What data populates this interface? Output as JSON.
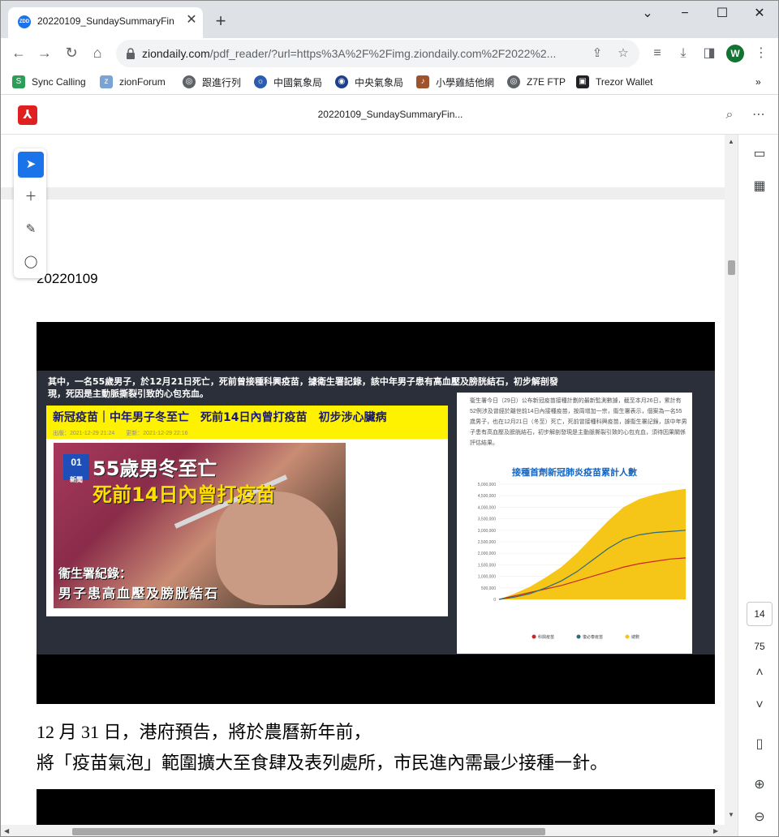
{
  "browser": {
    "tab": {
      "favicon_text": "ZDD",
      "title": "20220109_SundaySummaryFin",
      "close": "✕"
    },
    "new_tab": "+",
    "window_controls": {
      "minimize": "−",
      "maximize": "☐",
      "close": "✕"
    },
    "url_host": "ziondaily.com",
    "url_path": "/pdf_reader/?url=https%3A%2F%2Fimg.ziondaily.com%2F2022%2...",
    "profile_initial": "W"
  },
  "bookmarks": [
    {
      "label": "Sync Calling",
      "icon": "sync-calling-icon",
      "color": "#2e9d57"
    },
    {
      "label": "zionForum",
      "icon": "zionforum-icon",
      "color": "#7aa3d6"
    },
    {
      "label": "跟進行列",
      "icon": "globe-icon",
      "color": "#5f6368"
    },
    {
      "label": "中國氣象局",
      "icon": "cma-icon",
      "color": "#2a5db0"
    },
    {
      "label": "中央氣象局",
      "icon": "cwb-icon",
      "color": "#1e3f8a"
    },
    {
      "label": "小學雞結他網",
      "icon": "guitar-icon",
      "color": "#a0522d"
    },
    {
      "label": "Z7E FTP",
      "icon": "globe-icon",
      "color": "#5f6368"
    },
    {
      "label": "Trezor Wallet",
      "icon": "trezor-icon",
      "color": "#202124"
    }
  ],
  "pdf": {
    "title": "20220109_SundaySummaryFin...",
    "date_text": "20220109",
    "page_current": "14",
    "page_total": "75"
  },
  "article": {
    "quote": "其中，一名55歲男子，於12月21日死亡，死前曾接種科興疫苗，據衛生署記錄，該中年男子患有高血壓及膀胱結石，初步解剖發現，死因是主動脈撕裂引致的心包充血。",
    "headline": "新冠疫苗｜中年男子冬至亡　死前14日內曾打疫苗　初步涉心臟病",
    "meta": "出版：2021-12-29 21:24　　更新：2021-12-29 22:16",
    "badge": "01",
    "badge_sub": "新聞",
    "photo_h1": "55歲男冬至亡",
    "photo_h2": "死前14日內曾打疫苗",
    "photo_cap1": "衞生署紀錄：",
    "photo_cap2": "男子患高血壓及膀胱結石",
    "chart_note": "衞生署今日（29日）公布新冠疫苗接種計劃的最新監測數據，截至本月26日，累計有52例涉及曾經於離世前14日內接種疫苗，按周增加一宗，衞生署表示，個案為一名55歲男子，也在12月21日（冬至）死亡，死前曾接種科興疫苗，據衞生署記錄，該中年男子患有高血壓及膀胱結石，初步解剖發現是主動脈撕裂引致的心包充血，須待因果關係評估結果。",
    "chart_title": "接種首劑新冠肺炎疫苗累計人數",
    "body_line1": "12 月 31 日，港府預告，將於農曆新年前，",
    "body_line2": "將「疫苗氣泡」範圍擴大至食肆及表列處所，市民進內需最少接種一針。"
  },
  "chart_data": {
    "type": "area",
    "title": "接種首劑新冠肺炎疫苗累計人數",
    "ylim": [
      0,
      5000000
    ],
    "yticks": [
      "0",
      "500,000",
      "1,000,000",
      "1,500,000",
      "2,000,000",
      "2,500,000",
      "3,000,000",
      "3,500,000",
      "4,000,000",
      "4,500,000",
      "5,000,000"
    ],
    "series": [
      {
        "name": "科興疫苗",
        "color": "#c62828",
        "values": [
          0,
          150000,
          300000,
          450000,
          600000,
          800000,
          1000000,
          1200000,
          1400000,
          1550000,
          1650000,
          1750000,
          1800000
        ]
      },
      {
        "name": "復必泰疫苗",
        "color": "#2e6b78",
        "values": [
          0,
          100000,
          250000,
          500000,
          800000,
          1200000,
          1700000,
          2200000,
          2600000,
          2800000,
          2900000,
          2950000,
          3000000
        ]
      },
      {
        "name": "總數",
        "color": "#f5c518",
        "values": [
          0,
          250000,
          550000,
          950000,
          1400000,
          2000000,
          2700000,
          3400000,
          4000000,
          4350000,
          4550000,
          4700000,
          4800000
        ]
      }
    ]
  },
  "tools": {
    "select": "➤",
    "add_comment": "＋",
    "draw": "✎",
    "lasso": "◯"
  }
}
